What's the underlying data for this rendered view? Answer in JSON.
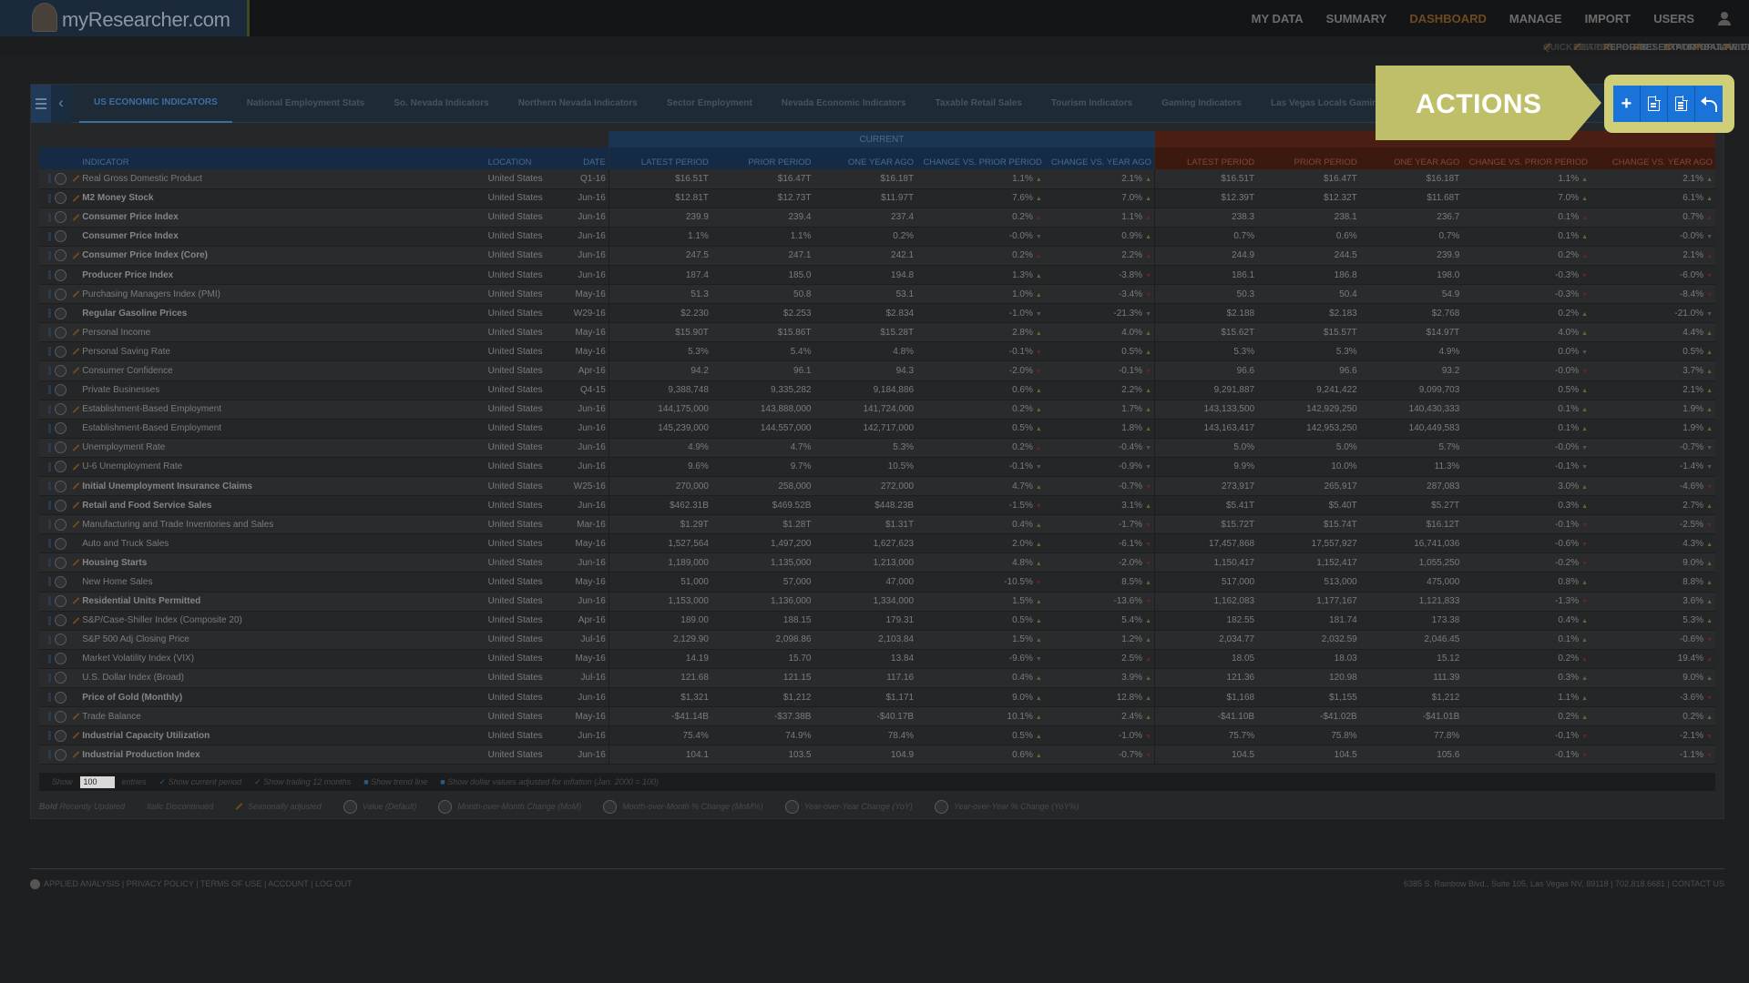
{
  "brand": {
    "name": "myResearcher.com",
    "reg": "®"
  },
  "main_nav": [
    {
      "label": "MY DATA",
      "active": false
    },
    {
      "label": "SUMMARY",
      "active": false
    },
    {
      "label": "DASHBOARD",
      "active": true
    },
    {
      "label": "MANAGE",
      "active": false
    },
    {
      "label": "IMPORT",
      "active": false
    },
    {
      "label": "USERS",
      "active": false
    }
  ],
  "sub_nav": [
    {
      "label": "QUICK SEARCH",
      "dim": true
    },
    {
      "label": "EDIT DASHBOARD",
      "dim": true
    },
    {
      "label": "REPORTS",
      "dim": false
    },
    {
      "label": "PRESENTATIONS",
      "dim": false
    },
    {
      "label": "EXPORT DATA",
      "dim": false
    },
    {
      "label": "POPULAR DASHBOARDS",
      "dim": false
    },
    {
      "label": "TWITTER UPDATES",
      "dim": false
    }
  ],
  "tabs": [
    "US ECONOMIC INDICATORS",
    "National Employment Stats",
    "So. Nevada Indicators",
    "Northern Nevada Indicators",
    "Sector Employment",
    "Nevada Economic Indicators",
    "Taxable Retail Sales",
    "Tourism Indicators",
    "Gaming Indicators",
    "Las Vegas Locals Gaming"
  ],
  "callout": {
    "label": "ACTIONS",
    "buttons": [
      "add-icon",
      "pdf-icon",
      "document-icon",
      "undo-icon"
    ]
  },
  "table": {
    "group_current": "CURRENT",
    "group_prior": "",
    "headers": [
      "INDICATOR",
      "LOCATION",
      "DATE",
      "LATEST PERIOD",
      "PRIOR PERIOD",
      "ONE YEAR AGO",
      "CHANGE VS. PRIOR PERIOD",
      "CHANGE VS. YEAR AGO",
      "LATEST PERIOD",
      "PRIOR PERIOD",
      "ONE YEAR AGO",
      "CHANGE VS. PRIOR PERIOD",
      "CHANGE VS. YEAR AGO"
    ],
    "rows": [
      [
        "Real Gross Domestic Product",
        "United States",
        "Q1-16",
        "$16.51T",
        "$16.47T",
        "$16.18T",
        "1.1%",
        "u",
        "2.1%",
        "u",
        "$16.51T",
        "$16.47T",
        "$16.18T",
        "1.1%",
        "u",
        "2.1%",
        "u",
        0,
        1
      ],
      [
        "M2 Money Stock",
        "United States",
        "Jun-16",
        "$12.81T",
        "$12.73T",
        "$11.97T",
        "7.6%",
        "u",
        "7.0%",
        "u",
        "$12.39T",
        "$12.32T",
        "$11.68T",
        "7.0%",
        "u",
        "6.1%",
        "u",
        1,
        1
      ],
      [
        "Consumer Price Index",
        "United States",
        "Jun-16",
        "239.9",
        "239.4",
        "237.4",
        "0.2%",
        "U",
        "1.1%",
        "U",
        "238.3",
        "238.1",
        "236.7",
        "0.1%",
        "U",
        "0.7%",
        "U",
        1,
        1
      ],
      [
        "Consumer Price Index",
        "United States",
        "Jun-16",
        "1.1%",
        "1.1%",
        "0.2%",
        "-0.0%",
        "n",
        "0.9%",
        "u",
        "0.7%",
        "0.6%",
        "0.7%",
        "0.1%",
        "u",
        "-0.0%",
        "n",
        1,
        0
      ],
      [
        "Consumer Price Index (Core)",
        "United States",
        "Jun-16",
        "247.5",
        "247.1",
        "242.1",
        "0.2%",
        "U",
        "2.2%",
        "U",
        "244.9",
        "244.5",
        "239.9",
        "0.2%",
        "U",
        "2.1%",
        "U",
        1,
        1
      ],
      [
        "Producer Price Index",
        "United States",
        "Jun-16",
        "187.4",
        "185.0",
        "194.8",
        "1.3%",
        "u",
        "-3.8%",
        "d",
        "186.1",
        "186.8",
        "198.0",
        "-0.3%",
        "d",
        "-6.0%",
        "d",
        1,
        0
      ],
      [
        "Purchasing Managers Index (PMI)",
        "United States",
        "May-16",
        "51.3",
        "50.8",
        "53.1",
        "1.0%",
        "u",
        "-3.4%",
        "d",
        "50.3",
        "50.4",
        "54.9",
        "-0.3%",
        "d",
        "-8.4%",
        "d",
        0,
        1
      ],
      [
        "Regular Gasoline Prices",
        "United States",
        "W29-16",
        "$2.230",
        "$2.253",
        "$2.834",
        "-1.0%",
        "n",
        "-21.3%",
        "n",
        "$2.188",
        "$2.183",
        "$2.768",
        "0.2%",
        "u",
        "-21.0%",
        "n",
        1,
        0
      ],
      [
        "Personal Income",
        "United States",
        "May-16",
        "$15.90T",
        "$15.86T",
        "$15.28T",
        "2.8%",
        "u",
        "4.0%",
        "u",
        "$15.62T",
        "$15.57T",
        "$14.97T",
        "4.0%",
        "u",
        "4.4%",
        "u",
        0,
        1
      ],
      [
        "Personal Saving Rate",
        "United States",
        "May-16",
        "5.3%",
        "5.4%",
        "4.8%",
        "-0.1%",
        "d",
        "0.5%",
        "u",
        "5.3%",
        "5.3%",
        "4.9%",
        "0.0%",
        "n",
        "0.5%",
        "u",
        0,
        1
      ],
      [
        "Consumer Confidence",
        "United States",
        "Apr-16",
        "94.2",
        "96.1",
        "94.3",
        "-2.0%",
        "d",
        "-0.1%",
        "d",
        "96.6",
        "96.6",
        "93.2",
        "-0.0%",
        "d",
        "3.7%",
        "u",
        0,
        1
      ],
      [
        "Private Businesses",
        "United States",
        "Q4-15",
        "9,388,748",
        "9,335,282",
        "9,184,886",
        "0.6%",
        "u",
        "2.2%",
        "u",
        "9,291,887",
        "9,241,422",
        "9,099,703",
        "0.5%",
        "u",
        "2.1%",
        "u",
        0,
        0
      ],
      [
        "Establishment-Based Employment",
        "United States",
        "Jun-16",
        "144,175,000",
        "143,888,000",
        "141,724,000",
        "0.2%",
        "u",
        "1.7%",
        "u",
        "143,133,500",
        "142,929,250",
        "140,430,333",
        "0.1%",
        "u",
        "1.9%",
        "u",
        0,
        1
      ],
      [
        "Establishment-Based Employment",
        "United States",
        "Jun-16",
        "145,239,000",
        "144,557,000",
        "142,717,000",
        "0.5%",
        "u",
        "1.8%",
        "u",
        "143,163,417",
        "142,953,250",
        "140,449,583",
        "0.1%",
        "u",
        "1.9%",
        "u",
        0,
        0
      ],
      [
        "Unemployment Rate",
        "United States",
        "Jun-16",
        "4.9%",
        "4.7%",
        "5.3%",
        "0.2%",
        "U",
        "-0.4%",
        "n",
        "5.0%",
        "5.0%",
        "5.7%",
        "-0.0%",
        "n",
        "-0.7%",
        "n",
        0,
        1
      ],
      [
        "U-6 Unemployment Rate",
        "United States",
        "Jun-16",
        "9.6%",
        "9.7%",
        "10.5%",
        "-0.1%",
        "n",
        "-0.9%",
        "n",
        "9.9%",
        "10.0%",
        "11.3%",
        "-0.1%",
        "n",
        "-1.4%",
        "n",
        0,
        1
      ],
      [
        "Initial Unemployment Insurance Claims",
        "United States",
        "W25-16",
        "270,000",
        "258,000",
        "272,000",
        "4.7%",
        "u",
        "-0.7%",
        "d",
        "273,917",
        "265,917",
        "287,083",
        "3.0%",
        "u",
        "-4.6%",
        "d",
        1,
        1
      ],
      [
        "Retail and Food Service Sales",
        "United States",
        "Jun-16",
        "$462.31B",
        "$469.52B",
        "$448.23B",
        "-1.5%",
        "d",
        "3.1%",
        "u",
        "$5.41T",
        "$5.40T",
        "$5.27T",
        "0.3%",
        "u",
        "2.7%",
        "u",
        1,
        1
      ],
      [
        "Manufacturing and Trade Inventories and Sales",
        "United States",
        "Mar-16",
        "$1.29T",
        "$1.28T",
        "$1.31T",
        "0.4%",
        "u",
        "-1.7%",
        "d",
        "$15.72T",
        "$15.74T",
        "$16.12T",
        "-0.1%",
        "d",
        "-2.5%",
        "d",
        0,
        1
      ],
      [
        "Auto and Truck Sales",
        "United States",
        "May-16",
        "1,527,564",
        "1,497,200",
        "1,627,623",
        "2.0%",
        "u",
        "-6.1%",
        "d",
        "17,457,868",
        "17,557,927",
        "16,741,036",
        "-0.6%",
        "d",
        "4.3%",
        "u",
        0,
        0
      ],
      [
        "Housing Starts",
        "United States",
        "Jun-16",
        "1,189,000",
        "1,135,000",
        "1,213,000",
        "4.8%",
        "u",
        "-2.0%",
        "d",
        "1,150,417",
        "1,152,417",
        "1,055,250",
        "-0.2%",
        "d",
        "9.0%",
        "u",
        1,
        1
      ],
      [
        "New Home Sales",
        "United States",
        "May-16",
        "51,000",
        "57,000",
        "47,000",
        "-10.5%",
        "d",
        "8.5%",
        "u",
        "517,000",
        "513,000",
        "475,000",
        "0.8%",
        "u",
        "8.8%",
        "u",
        0,
        0
      ],
      [
        "Residential Units Permitted",
        "United States",
        "Jun-16",
        "1,153,000",
        "1,136,000",
        "1,334,000",
        "1.5%",
        "u",
        "-13.6%",
        "d",
        "1,162,083",
        "1,177,167",
        "1,121,833",
        "-1.3%",
        "d",
        "3.6%",
        "u",
        1,
        1
      ],
      [
        "S&P/Case-Shiller Index (Composite 20)",
        "United States",
        "Apr-16",
        "189.00",
        "188.15",
        "179.31",
        "0.5%",
        "u",
        "5.4%",
        "u",
        "182.55",
        "181.74",
        "173.38",
        "0.4%",
        "u",
        "5.3%",
        "u",
        0,
        1
      ],
      [
        "S&P 500 Adj Closing Price",
        "United States",
        "Jul-16",
        "2,129.90",
        "2,098.86",
        "2,103.84",
        "1.5%",
        "u",
        "1.2%",
        "u",
        "2,034.77",
        "2,032.59",
        "2,046.45",
        "0.1%",
        "u",
        "-0.6%",
        "d",
        0,
        0
      ],
      [
        "Market Volatility Index (VIX)",
        "United States",
        "May-16",
        "14.19",
        "15.70",
        "13.84",
        "-9.6%",
        "n",
        "2.5%",
        "U",
        "18.05",
        "18.03",
        "15.12",
        "0.2%",
        "U",
        "19.4%",
        "U",
        0,
        0
      ],
      [
        "U.S. Dollar Index (Broad)",
        "United States",
        "Jul-16",
        "121.68",
        "121.15",
        "117.16",
        "0.4%",
        "u",
        "3.9%",
        "u",
        "121.36",
        "120.98",
        "111.39",
        "0.3%",
        "u",
        "9.0%",
        "u",
        0,
        0
      ],
      [
        "Price of Gold (Monthly)",
        "United States",
        "Jun-16",
        "$1,321",
        "$1,212",
        "$1,171",
        "9.0%",
        "u",
        "12.8%",
        "u",
        "$1,168",
        "$1,155",
        "$1,212",
        "1.1%",
        "u",
        "-3.6%",
        "d",
        1,
        0
      ],
      [
        "Trade Balance",
        "United States",
        "May-16",
        "-$41.14B",
        "-$37.38B",
        "-$40.17B",
        "10.1%",
        "u",
        "2.4%",
        "u",
        "-$41.10B",
        "-$41.02B",
        "-$41.01B",
        "0.2%",
        "u",
        "0.2%",
        "u",
        0,
        1
      ],
      [
        "Industrial Capacity Utilization",
        "United States",
        "Jun-16",
        "75.4%",
        "74.9%",
        "78.4%",
        "0.5%",
        "u",
        "-1.0%",
        "d",
        "75.7%",
        "75.8%",
        "77.8%",
        "-0.1%",
        "d",
        "-2.1%",
        "d",
        1,
        1
      ],
      [
        "Industrial Production Index",
        "United States",
        "Jun-16",
        "104.1",
        "103.5",
        "104.9",
        "0.6%",
        "u",
        "-0.7%",
        "d",
        "104.5",
        "104.5",
        "105.6",
        "-0.1%",
        "d",
        "-1.1%",
        "d",
        1,
        1
      ]
    ]
  },
  "options": {
    "show_label": "Show",
    "entries_value": "100",
    "entries_label": "entries",
    "checks": [
      {
        "label": "Show current period",
        "checked": true
      },
      {
        "label": "Show trailing 12 months",
        "checked": true
      },
      {
        "label": "Show trend line",
        "checked": false
      },
      {
        "label": "Show dollar values adjusted for inflation (Jan. 2000 = 100)",
        "checked": false
      }
    ]
  },
  "legend": {
    "bold": "Bold",
    "bold_text": "Recently Updated",
    "italic": "Italic",
    "italic_text": "Discontinued",
    "seasonal": "Seasonally adjusted",
    "icons": [
      "Value (Default)",
      "Month-over-Month Change (MoM)",
      "Month-over-Month % Change (MoM%)",
      "Year-over-Year Change (YoY)",
      "Year-over-Year % Change (YoY%)"
    ]
  },
  "footer": {
    "links": [
      "APPLIED ANALYSIS",
      "PRIVACY POLICY",
      "TERMS OF USE",
      "ACCOUNT",
      "LOG OUT"
    ],
    "address": "6385 S. Rainbow Blvd., Suite 105, Las Vegas NV, 89118 | 702.818.6681 | CONTACT US"
  }
}
